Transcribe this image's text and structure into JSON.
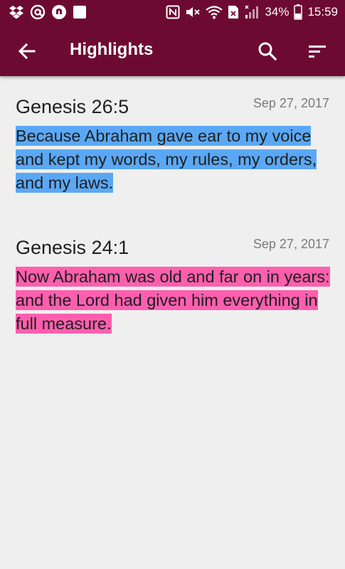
{
  "status_bar": {
    "battery_percent": "34%",
    "time": "15:59",
    "icons": [
      "dropbox-icon",
      "at-icon",
      "notification-icon",
      "square-icon",
      "nfc-icon",
      "mute-icon",
      "wifi-icon",
      "sim-icon",
      "signal-icon",
      "battery-icon"
    ]
  },
  "app_bar": {
    "title": "Highlights",
    "back_icon": "arrow-left-icon",
    "search_icon": "search-icon",
    "sort_icon": "sort-icon"
  },
  "highlights": [
    {
      "reference": "Genesis 26:5",
      "date": "Sep 27, 2017",
      "text": "Because Abraham gave ear to my voice and kept my words, my rules, my orders, and my laws.",
      "color": "#5aa8f5"
    },
    {
      "reference": "Genesis 24:1",
      "date": "Sep 27, 2017",
      "text": "Now Abraham was old and far on in years: and the Lord had given him everything in full measure.",
      "color": "#fd5fae"
    }
  ],
  "colors": {
    "primary": "#6d0a31",
    "background": "#efefef",
    "highlight_blue": "#5aa8f5",
    "highlight_pink": "#fd5fae"
  }
}
